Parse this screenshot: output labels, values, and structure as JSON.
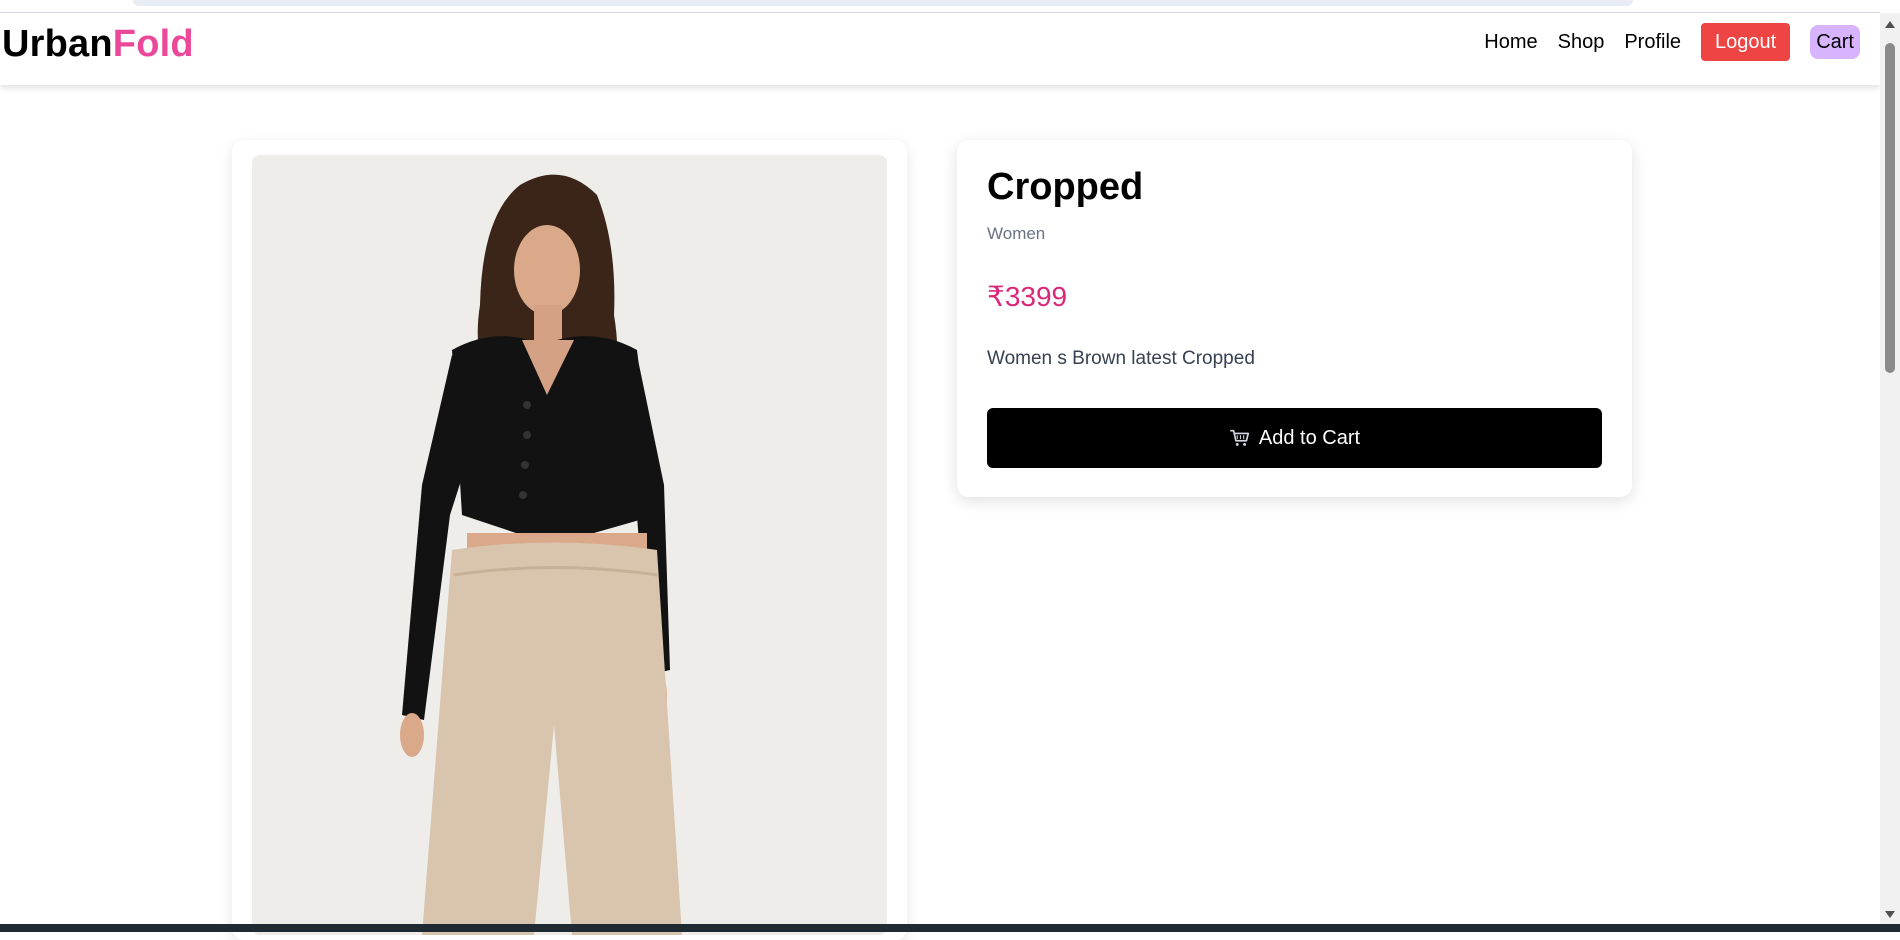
{
  "brand": {
    "part1": "Urban",
    "part2": "Fold",
    "accent_color": "#ec4899"
  },
  "nav": {
    "home": "Home",
    "shop": "Shop",
    "profile": "Profile",
    "logout": "Logout",
    "cart": "Cart",
    "logout_color": "#ef4444",
    "cart_color": "#d8b4fe"
  },
  "product": {
    "title": "Cropped",
    "category": "Women",
    "price": "₹3399",
    "price_color": "#db2777",
    "description": "Women s Brown latest Cropped",
    "add_to_cart": "Add to Cart",
    "image_icon": "product-photo"
  },
  "icons": {
    "cart_button_icon": "cart-icon"
  }
}
